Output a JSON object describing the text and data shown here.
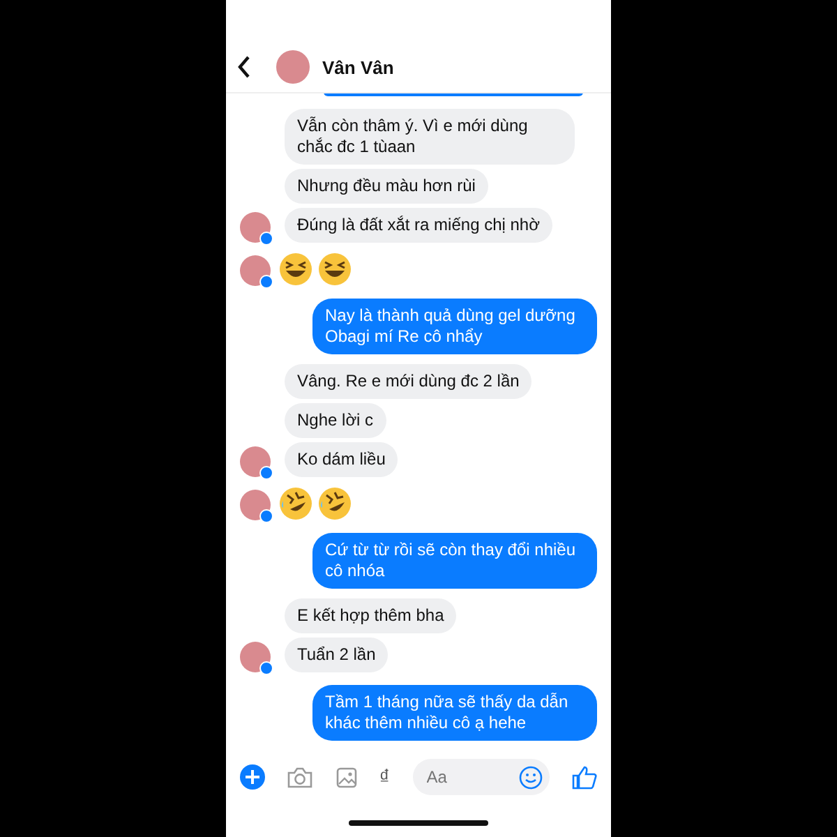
{
  "header": {
    "contact_name": "Vân Vân"
  },
  "groups": [
    {
      "kind": "received",
      "bubbles": [
        "Vẫn còn thâm ý. Vì e mới dùng chắc đc 1 tùaan",
        "Nhưng đều màu hơn rùi",
        "Đúng là đất xắt ra miếng chị nhờ"
      ]
    },
    {
      "kind": "emoji",
      "emojis": [
        {
          "kind": "squint"
        },
        {
          "kind": "squint"
        }
      ]
    },
    {
      "kind": "sent",
      "bubbles": [
        "Nay là thành quả dùng gel dưỡng Obagi mí Re cô nhẩy"
      ]
    },
    {
      "kind": "received",
      "bubbles": [
        "Vâng. Re e mới dùng đc 2 lần",
        "Nghe lời c",
        "Ko dám liều"
      ]
    },
    {
      "kind": "emoji",
      "emojis": [
        {
          "kind": "rofl"
        },
        {
          "kind": "rofl"
        }
      ]
    },
    {
      "kind": "sent",
      "bubbles": [
        "Cứ từ từ rồi sẽ còn thay đổi nhiều cô nhóa"
      ]
    },
    {
      "kind": "received",
      "bubbles": [
        "E kết hợp thêm bha",
        "Tuẩn 2 lần"
      ]
    },
    {
      "kind": "sent",
      "bubbles": [
        "Tầm 1 tháng nữa sẽ thấy da dẫn khác thêm nhiều cô ạ hehe"
      ]
    }
  ],
  "composer": {
    "currency_symbol": "₫",
    "placeholder": "Aa"
  }
}
